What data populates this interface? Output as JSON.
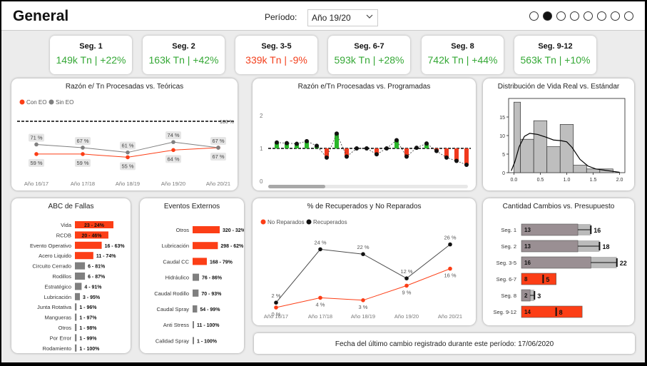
{
  "header": {
    "title": "General",
    "period_label": "Período:",
    "period_value": "Año 19/20",
    "page_count": 8,
    "active_page": 2
  },
  "colors": {
    "positive": "#35a836",
    "negative": "#f3401d",
    "orange": "#fc3e16",
    "gray": "#7f7f7f",
    "green_bar": "#2ab62a",
    "red_bar": "#f0391d",
    "hist": "#bebebe"
  },
  "kpis": [
    {
      "name": "Seg. 1",
      "value": "149k Tn | +22%",
      "positive": true
    },
    {
      "name": "Seg. 2",
      "value": "163k Tn | +42%",
      "positive": true
    },
    {
      "name": "Seg. 3-5",
      "value": "339k Tn | -9%",
      "positive": false
    },
    {
      "name": "Seg. 6-7",
      "value": "593k Tn | +28%",
      "positive": true
    },
    {
      "name": "Seg. 8",
      "value": "742k Tn | +44%",
      "positive": true
    },
    {
      "name": "Seg. 9-12",
      "value": "563k Tn | +10%",
      "positive": true
    }
  ],
  "cards": {
    "razon_teoricas": "Razón e/ Tn Procesadas vs. Teóricas",
    "razon_programadas": "Razón e/Tn Procesadas vs. Programadas",
    "distribucion": "Distribución de Vida Real vs. Estándar",
    "abc": "ABC de Fallas",
    "eventos": "Eventos Externos",
    "recuperados": "% de Recuperados y No Reparados",
    "cambios": "Cantidad Cambios vs. Presupuesto"
  },
  "footer": "Fecha del último cambio registrado durante este período: 17/06/2020",
  "chart_data": [
    {
      "id": "razon_teoricas",
      "type": "line",
      "categories": [
        "Año 16/17",
        "Año 17/18",
        "Año 18/19",
        "Año 19/20",
        "Año 20/21"
      ],
      "series": [
        {
          "name": "Con EO",
          "values": [
            59,
            59,
            55,
            64,
            67
          ],
          "labels": [
            "59 %",
            "59 %",
            "55 %",
            "64 %",
            "67 %"
          ]
        },
        {
          "name": "Sin EO",
          "values": [
            71,
            67,
            61,
            74,
            67
          ],
          "labels": [
            "71 %",
            "67 %",
            "61 %",
            "74 %",
            "67 %"
          ]
        }
      ],
      "reference": 100,
      "reference_label": "100 %"
    },
    {
      "id": "razon_programadas",
      "type": "bar",
      "yticks": [
        "0",
        "1",
        "2"
      ],
      "ylim": [
        0,
        2.2
      ],
      "baseline": 1,
      "values": [
        1.18,
        1.16,
        1.14,
        1.22,
        1.08,
        0.72,
        1.45,
        0.75,
        1.0,
        1.0,
        0.82,
        1.0,
        1.25,
        0.75,
        1.02,
        1.15,
        0.92,
        0.72,
        0.62,
        0.5
      ]
    },
    {
      "id": "distribucion",
      "type": "bar",
      "yticks": [
        "0",
        "5",
        "10",
        "15"
      ],
      "xticks": [
        "0.0",
        "0.5",
        "1.0",
        "1.5",
        "2.0"
      ],
      "bins": [
        0,
        0.125,
        0.375,
        0.625,
        0.875,
        1.125,
        1.375,
        1.625,
        1.875
      ],
      "counts": [
        19,
        9,
        14,
        7,
        13,
        2,
        1,
        1
      ],
      "ylim": [
        0,
        20
      ],
      "xlim": [
        -0.1,
        2.1
      ]
    },
    {
      "id": "abc",
      "type": "bar",
      "categories": [
        "Vida",
        "RCDB",
        "Evento Operativo",
        "Acero Liquido",
        "Circuito Cerrado",
        "Rodillos",
        "Estratégico",
        "Lubricación",
        "Junta Rotativa",
        "Mangueras",
        "Otros",
        "Por Error",
        "Rodamiento"
      ],
      "values": [
        23,
        20,
        16,
        11,
        6,
        6,
        4,
        3,
        1,
        1,
        1,
        1,
        1
      ],
      "labels": [
        "23 - 24%",
        "20 - 46%",
        "16 - 63%",
        "11 - 74%",
        "6 - 81%",
        "6 - 87%",
        "4 - 91%",
        "3 - 95%",
        "1 - 96%",
        "1 - 97%",
        "1 - 98%",
        "1 - 99%",
        "1 - 100%"
      ],
      "highlight_count": 4
    },
    {
      "id": "eventos",
      "type": "bar",
      "categories": [
        "Otros",
        "Lubricación",
        "Caudal CC",
        "Hidráulico",
        "Caudal Rodillo",
        "Caudal Spray",
        "Anti Stress",
        "Calidad Spray"
      ],
      "values": [
        320,
        298,
        168,
        76,
        70,
        54,
        11,
        1
      ],
      "labels": [
        "320 - 32%",
        "298 - 62%",
        "168 - 79%",
        "76 - 86%",
        "70 - 93%",
        "54 - 99%",
        "11 - 100%",
        "1 - 100%"
      ],
      "highlight_count": 3
    },
    {
      "id": "recuperados",
      "type": "line",
      "categories": [
        "Año 16/17",
        "Año 17/18",
        "Año 18/19",
        "Año 19/20",
        "Año 20/21"
      ],
      "series": [
        {
          "name": "No Reparados",
          "values": [
            0,
            4,
            3,
            9,
            16
          ],
          "labels": [
            "0 %",
            "4 %",
            "3 %",
            "9 %",
            "16 %"
          ]
        },
        {
          "name": "Recuperados",
          "values": [
            2,
            24,
            22,
            12,
            26
          ],
          "labels": [
            "2 %",
            "24 %",
            "22 %",
            "12 %",
            "26 %"
          ]
        }
      ]
    },
    {
      "id": "cambios",
      "type": "bar",
      "categories": [
        "Seg. 1",
        "Seg. 2",
        "Seg. 3-5",
        "Seg. 6-7",
        "Seg. 8",
        "Seg. 9-12"
      ],
      "actual": [
        13,
        13,
        16,
        8,
        2,
        14
      ],
      "budget": [
        16,
        18,
        22,
        5,
        3,
        8
      ],
      "over_budget": [
        false,
        false,
        false,
        true,
        false,
        true
      ]
    }
  ]
}
